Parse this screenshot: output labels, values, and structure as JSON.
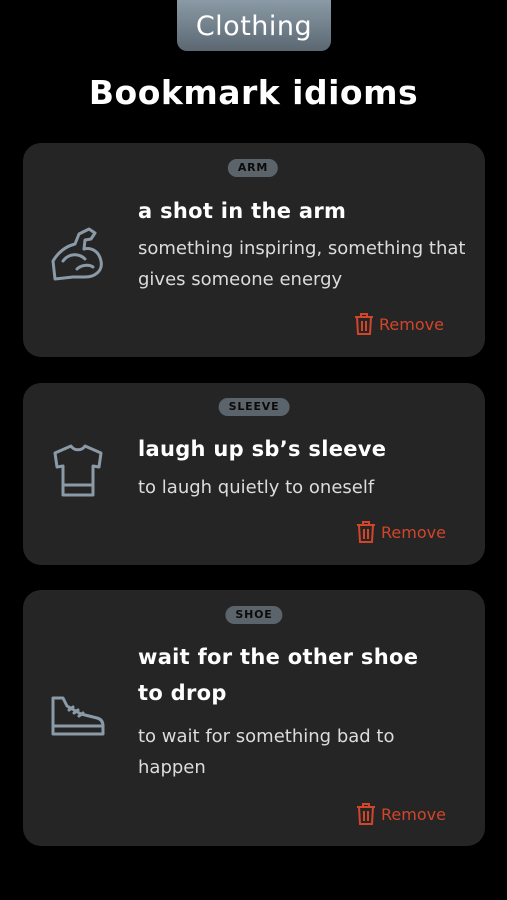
{
  "header": {
    "category_tab": "Clothing",
    "title": "Bookmark idioms"
  },
  "cards": [
    {
      "tag": "ARM",
      "icon": "flexed-arm-icon",
      "idiom": "a shot in the arm",
      "meaning": "something inspiring, something that gives someone energy",
      "remove_label": "Remove"
    },
    {
      "tag": "SLEEVE",
      "icon": "tshirt-icon",
      "idiom": "laugh up sb’s sleeve",
      "meaning": "to laugh quietly to oneself",
      "remove_label": "Remove"
    },
    {
      "tag": "SHOE",
      "icon": "sneaker-icon",
      "idiom": "wait for the other shoe to drop",
      "meaning": "to wait for something bad to happen",
      "remove_label": "Remove"
    }
  ],
  "colors": {
    "background": "#000000",
    "card": "#252526",
    "tag": "#5c646b",
    "icon": "#8a9aa6",
    "remove": "#d2452a"
  }
}
